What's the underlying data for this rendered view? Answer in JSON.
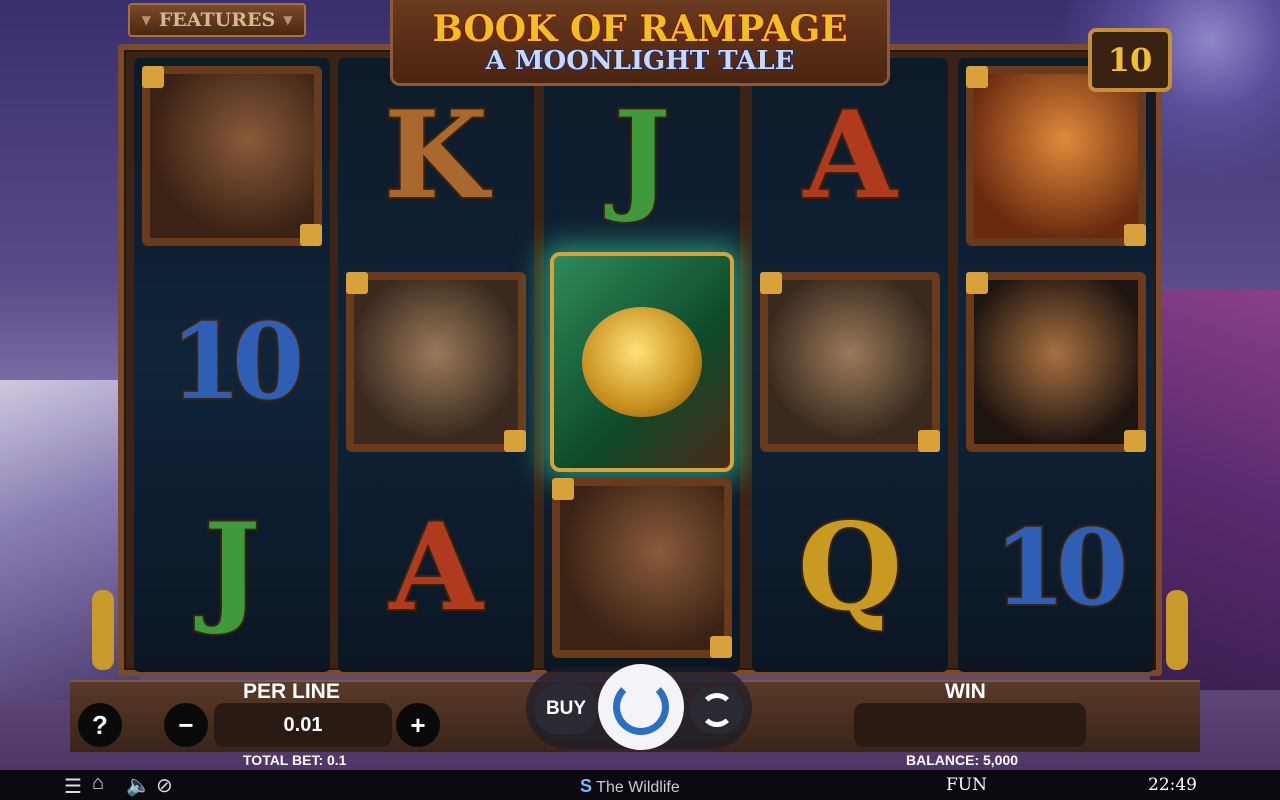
{
  "game": {
    "title_line1": "BOOK OF RAMPAGE",
    "title_line2": "A MOONLIGHT TALE",
    "features_label": "FEATURES",
    "multiplier_badge": "10"
  },
  "reels": [
    {
      "symbols": [
        {
          "kind": "card",
          "name": "horse-symbol"
        },
        {
          "kind": "letter",
          "text": "10",
          "color": "#2f5fb4"
        },
        {
          "kind": "letter",
          "text": "J",
          "color": "#3f9a3c"
        }
      ]
    },
    {
      "symbols": [
        {
          "kind": "letter",
          "text": "K",
          "color": "#a8682e"
        },
        {
          "kind": "card",
          "name": "wolf-symbol"
        },
        {
          "kind": "letter",
          "text": "A",
          "color": "#b03a1e"
        }
      ]
    },
    {
      "symbols": [
        {
          "kind": "letter",
          "text": "J",
          "color": "#3f9a3c"
        },
        {
          "kind": "book",
          "name": "book-scatter-symbol"
        },
        {
          "kind": "card",
          "name": "horse-symbol"
        }
      ]
    },
    {
      "symbols": [
        {
          "kind": "letter",
          "text": "A",
          "color": "#b03a1e"
        },
        {
          "kind": "card",
          "name": "wolf-symbol"
        },
        {
          "kind": "letter",
          "text": "Q",
          "color": "#c89a22"
        }
      ]
    },
    {
      "symbols": [
        {
          "kind": "card",
          "name": "snake-symbol"
        },
        {
          "kind": "card",
          "name": "bison-symbol"
        },
        {
          "kind": "letter",
          "text": "10",
          "color": "#2f5fb4"
        }
      ]
    }
  ],
  "controls": {
    "help_label": "?",
    "per_line_label": "PER LINE",
    "per_line_value": "0.01",
    "minus_label": "−",
    "plus_label": "+",
    "total_bet": "TOTAL BET: 0.1",
    "buy_label": "BUY",
    "win_label": "WIN",
    "win_value": "",
    "balance": "BALANCE: 5,000"
  },
  "footer": {
    "brand_name": "The Wildlife",
    "mode": "FUN",
    "clock": "22:49"
  },
  "colors": {
    "spin_ring": "#2b6fc2",
    "book_glow": "#3ce6a0"
  }
}
